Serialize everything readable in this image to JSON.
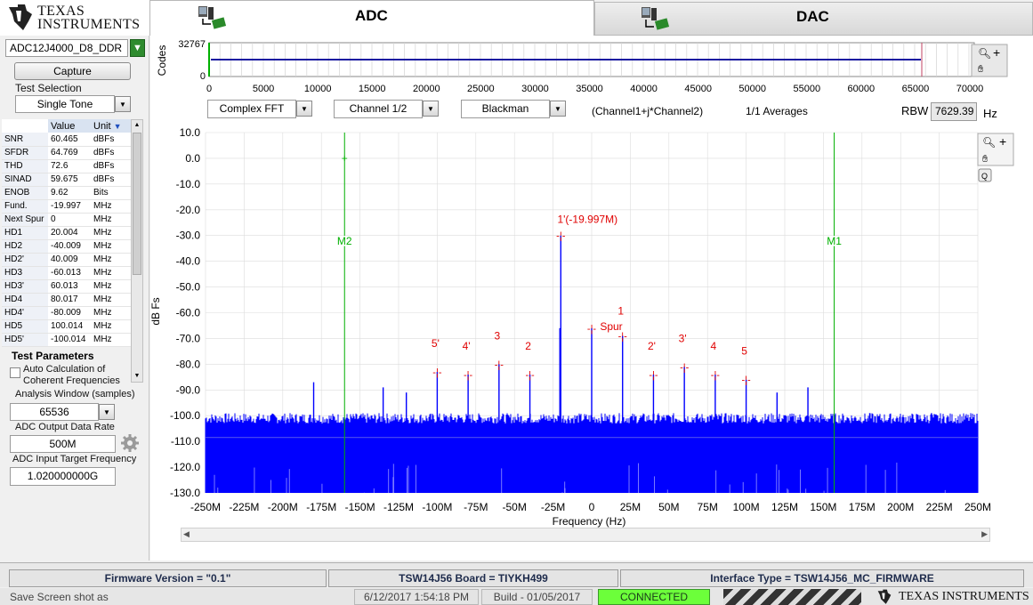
{
  "header": {
    "logo_line1": "Texas",
    "logo_line2": "Instruments",
    "tab_adc": "ADC",
    "tab_dac": "DAC"
  },
  "left": {
    "device_select": "ADC12J4000_D8_DDR",
    "capture_label": "Capture",
    "test_selection_label": "Test Selection",
    "test_selection_value": "Single Tone",
    "table_headers": [
      "Value",
      "Unit"
    ],
    "results": [
      {
        "name": "SNR",
        "value": "60.465",
        "unit": "dBFs"
      },
      {
        "name": "SFDR",
        "value": "64.769",
        "unit": "dBFs"
      },
      {
        "name": "THD",
        "value": "72.6",
        "unit": "dBFs"
      },
      {
        "name": "SINAD",
        "value": "59.675",
        "unit": "dBFs"
      },
      {
        "name": "ENOB",
        "value": "9.62",
        "unit": "Bits"
      },
      {
        "name": "Fund.",
        "value": "-19.997",
        "unit": "MHz"
      },
      {
        "name": "Next Spur",
        "value": "0",
        "unit": "MHz"
      },
      {
        "name": "HD1",
        "value": "20.004",
        "unit": "MHz"
      },
      {
        "name": "HD2",
        "value": "-40.009",
        "unit": "MHz"
      },
      {
        "name": "HD2'",
        "value": "40.009",
        "unit": "MHz"
      },
      {
        "name": "HD3",
        "value": "-60.013",
        "unit": "MHz"
      },
      {
        "name": "HD3'",
        "value": "60.013",
        "unit": "MHz"
      },
      {
        "name": "HD4",
        "value": "80.017",
        "unit": "MHz"
      },
      {
        "name": "HD4'",
        "value": "-80.009",
        "unit": "MHz"
      },
      {
        "name": "HD5",
        "value": "100.014",
        "unit": "MHz"
      },
      {
        "name": "HD5'",
        "value": "-100.014",
        "unit": "MHz"
      }
    ],
    "test_parameters_label": "Test Parameters",
    "auto_calc_label_1": "Auto Calculation of",
    "auto_calc_label_2": "Coherent Frequencies",
    "analysis_window_label": "Analysis Window (samples)",
    "analysis_window_value": "65536",
    "output_rate_label": "ADC Output Data Rate",
    "output_rate_value": "500M",
    "input_target_label": "ADC Input Target Frequency",
    "input_target_value": "1.020000000G"
  },
  "codes_plot": {
    "ylabel": "Codes",
    "y_ticks": [
      "32767",
      "0"
    ],
    "x_ticks": [
      "0",
      "5000",
      "10000",
      "15000",
      "20000",
      "25000",
      "30000",
      "35000",
      "40000",
      "45000",
      "50000",
      "55000",
      "60000",
      "65000",
      "70000"
    ]
  },
  "controls": {
    "fft_mode": "Complex FFT",
    "channel": "Channel 1/2",
    "window": "Blackman",
    "channel_expr": "(Channel1+j*Channel2)",
    "averages": "1/1 Averages",
    "rbw_label": "RBW",
    "rbw_value": "7629.39",
    "rbw_unit": "Hz"
  },
  "chart_data": {
    "type": "line",
    "xlabel": "Frequency (Hz)",
    "ylabel": "dB Fs",
    "x_ticks": [
      "-250M",
      "-225M",
      "-200M",
      "-175M",
      "-150M",
      "-125M",
      "-100M",
      "-75M",
      "-50M",
      "-25M",
      "0",
      "25M",
      "50M",
      "75M",
      "100M",
      "125M",
      "150M",
      "175M",
      "200M",
      "225M",
      "250M"
    ],
    "y_ticks": [
      "10.0",
      "0.0",
      "-10.0",
      "-20.0",
      "-30.0",
      "-40.0",
      "-50.0",
      "-60.0",
      "-70.0",
      "-80.0",
      "-90.0",
      "-100.0",
      "-110.0",
      "-120.0",
      "-130.0"
    ],
    "xlim": [
      -250,
      250
    ],
    "ylim": [
      -130,
      10
    ],
    "noise_floor_db": -105,
    "series_color": "#0000ff",
    "peaks": [
      {
        "x": -20,
        "y": -30
      },
      {
        "x": -20.6,
        "y": -66
      },
      {
        "x": 0,
        "y": -66
      },
      {
        "x": 20,
        "y": -69
      },
      {
        "x": -40,
        "y": -84
      },
      {
        "x": 40,
        "y": -84
      },
      {
        "x": -60,
        "y": -80
      },
      {
        "x": 60,
        "y": -81
      },
      {
        "x": -80,
        "y": -84
      },
      {
        "x": 80,
        "y": -84
      },
      {
        "x": -100,
        "y": -83
      },
      {
        "x": 100,
        "y": -86
      },
      {
        "x": -180,
        "y": -87
      },
      {
        "x": -135,
        "y": -89
      },
      {
        "x": -120,
        "y": -91
      },
      {
        "x": 120,
        "y": -91
      },
      {
        "x": 140,
        "y": -89
      },
      {
        "x": 180,
        "y": -99
      },
      {
        "x": 220,
        "y": -99
      }
    ],
    "markers": [
      {
        "label": "M2",
        "x": -160,
        "color": "#00b000"
      },
      {
        "label": "M1",
        "x": 157,
        "color": "#00b000"
      }
    ],
    "annotations": [
      {
        "text": "1'(-19.997M)",
        "x": -20,
        "y": -30
      },
      {
        "text": "1",
        "x": 20,
        "y": -69
      },
      {
        "text": "Spur",
        "x": 0,
        "y": -66
      },
      {
        "text": "2",
        "x": -40,
        "y": -84
      },
      {
        "text": "2'",
        "x": 40,
        "y": -84
      },
      {
        "text": "3",
        "x": -60,
        "y": -80
      },
      {
        "text": "3'",
        "x": 60,
        "y": -81
      },
      {
        "text": "4",
        "x": 80,
        "y": -84
      },
      {
        "text": "4'",
        "x": -80,
        "y": -84
      },
      {
        "text": "5",
        "x": 100,
        "y": -86
      },
      {
        "text": "5'",
        "x": -100,
        "y": -83
      }
    ],
    "annotation_color": "#e00000"
  },
  "status": {
    "firmware": "Firmware Version = \"0.1\"",
    "board": "TSW14J56 Board = TIYKH499",
    "interface": "Interface Type = TSW14J56_MC_FIRMWARE",
    "save_label": "Save Screen shot as",
    "datetime": "6/12/2017 1:54:18 PM",
    "build": "Build  - 01/05/2017",
    "connection": "CONNECTED",
    "footer_logo": "Texas Instruments"
  }
}
